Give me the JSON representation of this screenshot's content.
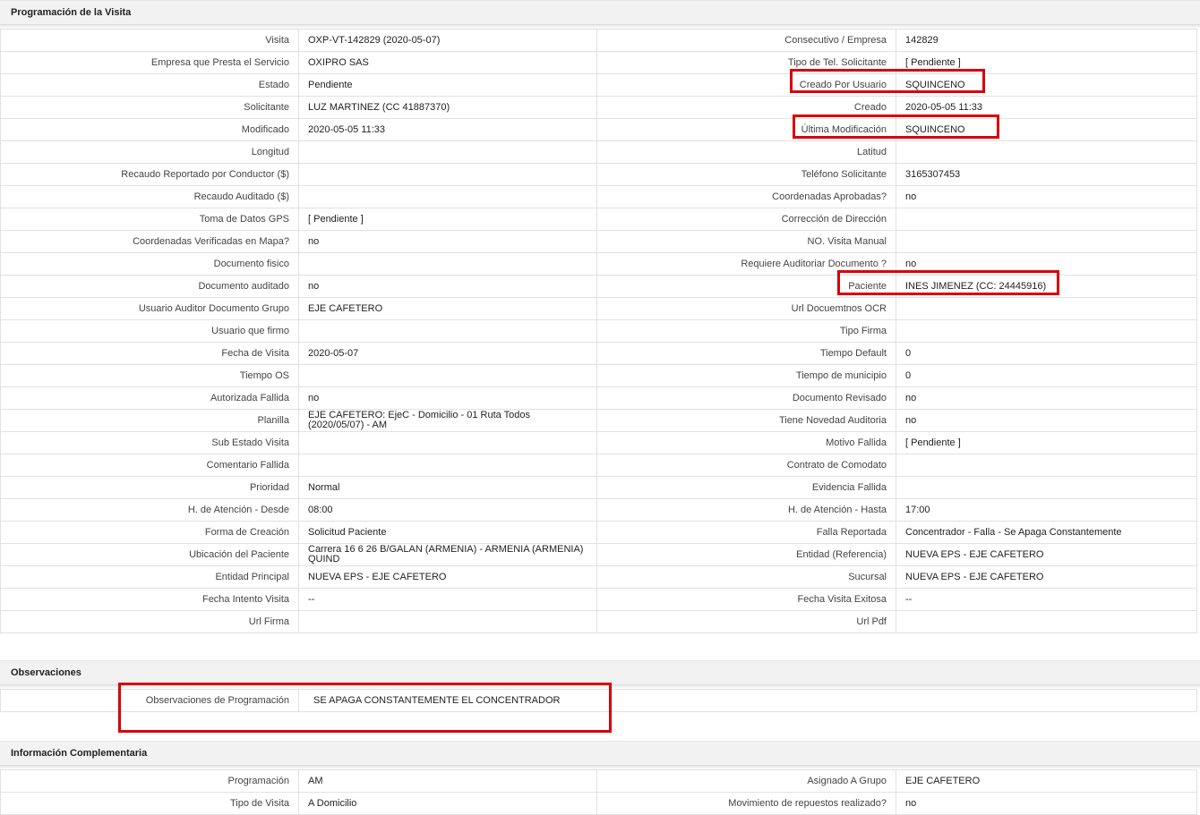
{
  "sections": {
    "programacion": "Programación de la Visita",
    "observaciones": "Observaciones",
    "complementaria": "Información Complementaria"
  },
  "rows": [
    {
      "l1": "Visita",
      "v1": "OXP-VT-142829 (2020-05-07)",
      "l2": "Consecutivo / Empresa",
      "v2": "142829"
    },
    {
      "l1": "Empresa que Presta el Servicio",
      "v1": "OXIPRO SAS",
      "l2": "Tipo de Tel. Solicitante",
      "v2": "[ Pendiente ]"
    },
    {
      "l1": "Estado",
      "v1": "Pendiente",
      "l2": "Creado Por Usuario",
      "v2": "SQUINCENO"
    },
    {
      "l1": "Solicitante",
      "v1": "LUZ MARTINEZ (CC 41887370)",
      "l2": "Creado",
      "v2": "2020-05-05 11:33"
    },
    {
      "l1": "Modificado",
      "v1": "2020-05-05 11:33",
      "l2": "Última Modificación",
      "v2": " SQUINCENO"
    },
    {
      "l1": "Longitud",
      "v1": "",
      "l2": "Latitud",
      "v2": ""
    },
    {
      "l1": "Recaudo Reportado por Conductor ($)",
      "v1": "",
      "l2": "Teléfono Solicitante",
      "v2": "3165307453"
    },
    {
      "l1": "Recaudo Auditado ($)",
      "v1": "",
      "l2": "Coordenadas Aprobadas?",
      "v2": " no"
    },
    {
      "l1": "Toma de Datos GPS",
      "v1": "[ Pendiente ]",
      "l2": "Corrección de Dirección",
      "v2": ""
    },
    {
      "l1": "Coordenadas Verificadas en Mapa?",
      "v1": " no",
      "l2": "NO. Visita Manual",
      "v2": ""
    },
    {
      "l1": "Documento fisico",
      "v1": "",
      "l2": "Requiere Auditoriar Documento ?",
      "v2": " no"
    },
    {
      "l1": "Documento auditado",
      "v1": " no",
      "l2": "Paciente",
      "v2": "INES JIMENEZ (CC: 24445916)"
    },
    {
      "l1": "Usuario Auditor Documento Grupo",
      "v1": "EJE CAFETERO",
      "l2": "Url Docuemtnos OCR",
      "v2": ""
    },
    {
      "l1": "Usuario que firmo",
      "v1": "",
      "l2": "Tipo Firma",
      "v2": ""
    },
    {
      "l1": "Fecha de Visita",
      "v1": " 2020-05-07",
      "l2": "Tiempo Default",
      "v2": "0"
    },
    {
      "l1": "Tiempo OS",
      "v1": "",
      "l2": "Tiempo de municipio",
      "v2": "0"
    },
    {
      "l1": "Autorizada Fallida",
      "v1": " no",
      "l2": "Documento Revisado",
      "v2": " no"
    },
    {
      "l1": "Planilla",
      "v1": "EJE CAFETERO: EjeC - Domicilio - 01 Ruta Todos (2020/05/07) - AM",
      "l2": "Tiene Novedad Auditoria",
      "v2": " no"
    },
    {
      "l1": "Sub Estado Visita",
      "v1": "",
      "l2": "Motivo Fallida",
      "v2": "[ Pendiente ]"
    },
    {
      "l1": "Comentario Fallida",
      "v1": "",
      "l2": "Contrato de Comodato",
      "v2": ""
    },
    {
      "l1": "Prioridad",
      "v1": "Normal",
      "l2": "Evidencia Fallida",
      "v2": ""
    },
    {
      "l1": "H. de Atención - Desde",
      "v1": "08:00",
      "l2": "H. de Atención - Hasta",
      "v2": "17:00"
    },
    {
      "l1": "Forma de Creación",
      "v1": "Solicitud Paciente",
      "l2": "Falla Reportada",
      "v2": "Concentrador - Falla - Se Apaga Constantemente"
    },
    {
      "l1": "Ubicación del Paciente",
      "v1": "Carrera 16 6 26 B/GALAN (ARMENIA) - ARMENIA (ARMENIA) QUIND",
      "l2": "Entidad (Referencia)",
      "v2": "NUEVA EPS - EJE CAFETERO"
    },
    {
      "l1": "Entidad Principal",
      "v1": "NUEVA EPS - EJE CAFETERO",
      "l2": "Sucursal",
      "v2": "NUEVA EPS - EJE CAFETERO"
    },
    {
      "l1": "Fecha Intento Visita",
      "v1": " --",
      "l2": "Fecha Visita Exitosa",
      "v2": " --"
    },
    {
      "l1": "Url Firma",
      "v1": "",
      "l2": "Url Pdf",
      "v2": ""
    }
  ],
  "observaciones": {
    "label": "Observaciones de Programación",
    "value": "SE APAGA CONSTANTEMENTE EL CONCENTRADOR"
  },
  "complementaria": [
    {
      "l1": "Programación",
      "v1": "AM",
      "l2": "Asignado A Grupo",
      "v2": "EJE CAFETERO"
    },
    {
      "l1": "Tipo de Visita",
      "v1": "A Domicilio",
      "l2": "Movimiento de repuestos realizado?",
      "v2": " no"
    }
  ],
  "colors": {
    "highlight": "#d8000c",
    "header_bg": "#f2f2f2",
    "border": "#e1e1e1"
  }
}
